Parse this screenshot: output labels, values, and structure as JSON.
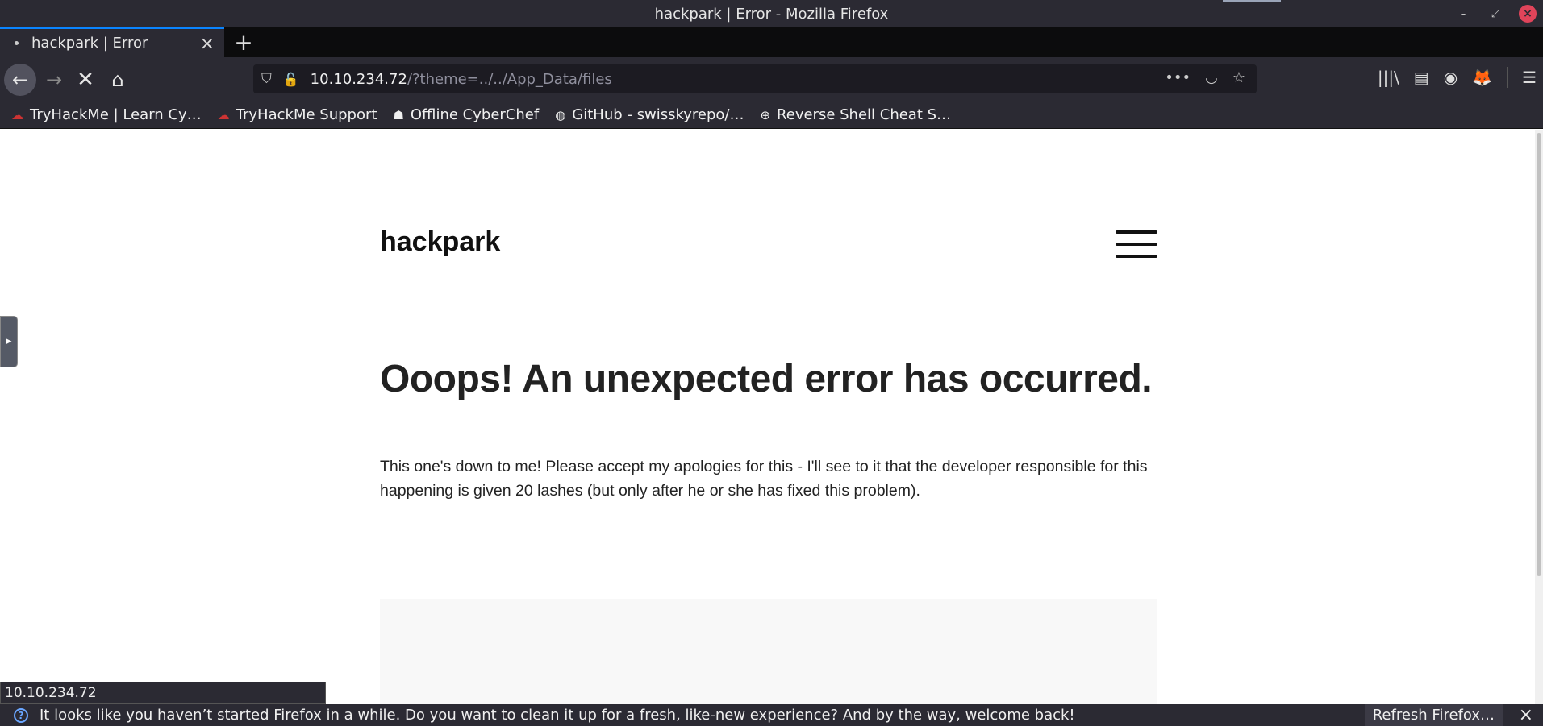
{
  "window": {
    "title": "hackpark | Error - Mozilla Firefox",
    "controls": {
      "minimize": "–",
      "restore": "⤢",
      "close": "×"
    }
  },
  "tabs": [
    {
      "label": "hackpark | Error",
      "active": true
    }
  ],
  "tabstrip": {
    "new_tab": "+",
    "tab_close": "×"
  },
  "nav": {
    "back_icon": "←",
    "forward_icon": "→",
    "stop_icon": "✕",
    "home_icon": "⌂",
    "url_host": "10.10.234.72",
    "url_path": "/?theme=../../App_Data/files",
    "page_actions_icon": "•••",
    "pocket_icon": "◡",
    "bookmark_star_icon": "☆"
  },
  "toolbar": {
    "library_icon": "|||\\",
    "sidebar_icon": "▤",
    "account_icon": "◉",
    "extension_icon": "🦊",
    "menu_icon": "☰"
  },
  "bookmarks": [
    {
      "label": "TryHackMe | Learn Cy…",
      "icon": "☁"
    },
    {
      "label": "TryHackMe Support",
      "icon": "☁"
    },
    {
      "label": "Offline CyberChef",
      "icon": "☗"
    },
    {
      "label": "GitHub - swisskyrepo/…",
      "icon": "◍"
    },
    {
      "label": "Reverse Shell Cheat S…",
      "icon": "⊕"
    }
  ],
  "page": {
    "site_title": "hackpark",
    "error_heading": "Ooops! An unexpected error has occurred.",
    "error_message": "This one's down to me! Please accept my apologies for this - I'll see to it that the developer responsible for this happening is given 20 lashes (but only after he or she has fixed this problem)."
  },
  "status": {
    "link_preview": "10.10.234.72"
  },
  "notification": {
    "message": "It looks like you haven’t started Firefox in a while. Do you want to clean it up for a fresh, like-new experience? And by the way, welcome back!",
    "button": "Refresh Firefox…",
    "help_icon": "?",
    "close_icon": "×"
  },
  "colors": {
    "chrome": "#2b2a33",
    "accent": "#0a84ff",
    "page_bg": "#ffffff"
  }
}
